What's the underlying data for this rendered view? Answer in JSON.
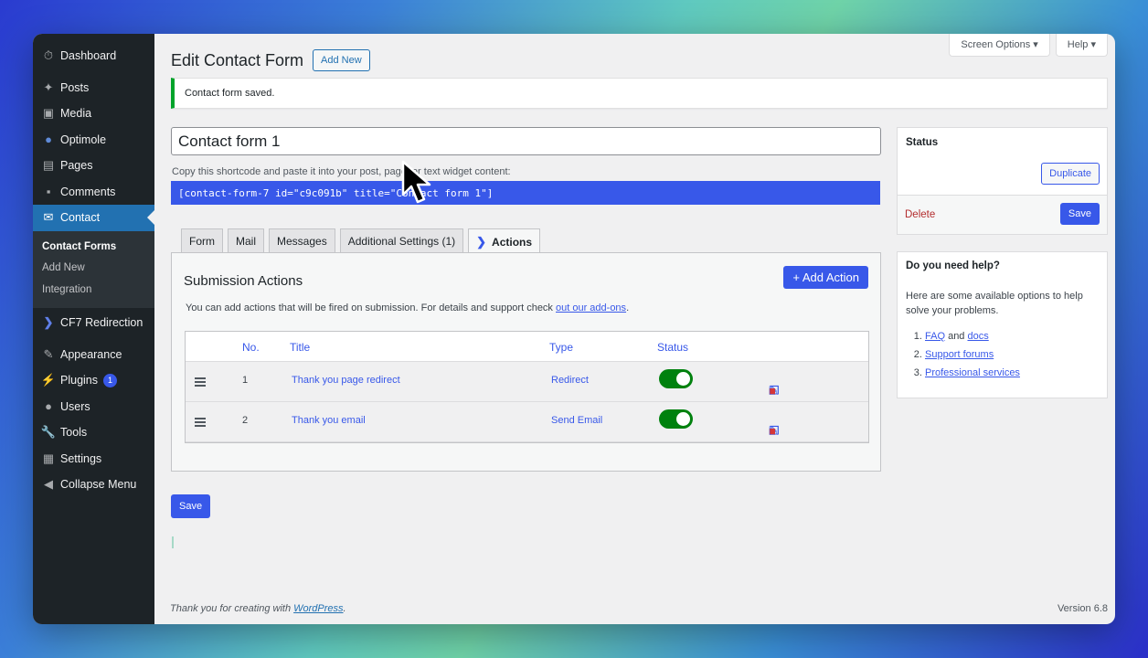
{
  "sidebar": {
    "items": [
      {
        "label": "Dashboard",
        "icon": "dashboard-icon"
      },
      {
        "label": "Posts",
        "icon": "pin-icon"
      },
      {
        "label": "Media",
        "icon": "media-icon"
      },
      {
        "label": "Optimole",
        "icon": "optimole-icon"
      },
      {
        "label": "Pages",
        "icon": "pages-icon"
      },
      {
        "label": "Comments",
        "icon": "comments-icon"
      },
      {
        "label": "Contact",
        "icon": "mail-icon"
      }
    ],
    "submenu": [
      "Contact Forms",
      "Add New",
      "Integration"
    ],
    "items2": [
      {
        "label": "CF7 Redirection",
        "icon": "chevron-right-icon"
      },
      {
        "label": "Appearance",
        "icon": "brush-icon"
      },
      {
        "label": "Plugins",
        "icon": "plugin-icon",
        "badge": "1"
      },
      {
        "label": "Users",
        "icon": "users-icon"
      },
      {
        "label": "Tools",
        "icon": "wrench-icon"
      },
      {
        "label": "Settings",
        "icon": "settings-icon"
      },
      {
        "label": "Collapse Menu",
        "icon": "collapse-icon"
      }
    ]
  },
  "header": {
    "screen_options": "Screen Options",
    "help": "Help",
    "title": "Edit Contact Form",
    "add_new": "Add New"
  },
  "notice": "Contact form saved.",
  "form": {
    "title_value": "Contact form 1",
    "shortcode_hint": "Copy this shortcode and paste it into your post, page, or text widget content:",
    "shortcode": "[contact-form-7 id=\"c9c091b\" title=\"Contact form 1\"]"
  },
  "tabs": [
    "Form",
    "Mail",
    "Messages",
    "Additional Settings (1)",
    "Actions"
  ],
  "actions_panel": {
    "heading": "Submission Actions",
    "add_button": "+ Add Action",
    "desc_prefix": "You can add actions that will be fired on submission. For details and support check ",
    "desc_link": "out our add-ons",
    "desc_suffix": ".",
    "columns": [
      "No.",
      "Title",
      "Type",
      "Status"
    ],
    "rows": [
      {
        "no": "1",
        "title": "Thank you page redirect",
        "type": "Redirect",
        "enabled": true
      },
      {
        "no": "2",
        "title": "Thank you email",
        "type": "Send Email",
        "enabled": true
      }
    ]
  },
  "save_label": "Save",
  "status_box": {
    "heading": "Status",
    "duplicate": "Duplicate",
    "delete": "Delete",
    "save": "Save"
  },
  "help_box": {
    "heading": "Do you need help?",
    "text": "Here are some available options to help solve your problems.",
    "item1_link1": "FAQ",
    "item1_and": " and ",
    "item1_link2": "docs",
    "item2": "Support forums",
    "item3": "Professional services"
  },
  "footer": {
    "thanks_prefix": "Thank you for creating with ",
    "thanks_link": "WordPress",
    "thanks_suffix": ".",
    "version": "Version 6.8"
  },
  "colors": {
    "accent": "#3858e9",
    "sidebar_bg": "#1d2327",
    "toggle_on": "#00810e",
    "delete": "#b32d2e"
  }
}
